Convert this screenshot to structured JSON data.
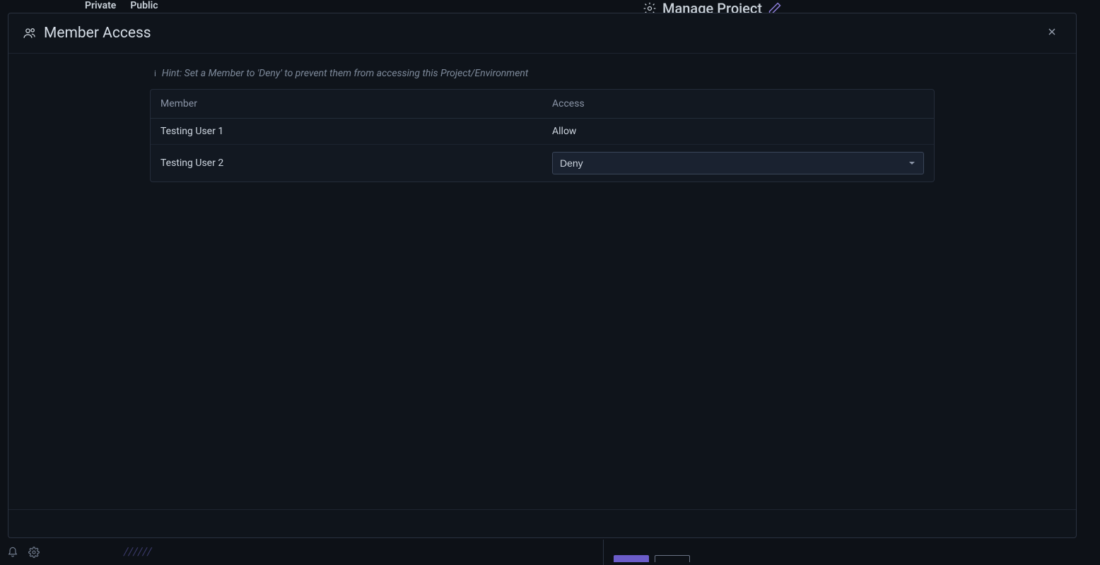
{
  "background": {
    "tabs": {
      "private": "Private",
      "public": "Public"
    },
    "manage_project": "Manage Project"
  },
  "modal": {
    "title": "Member Access",
    "hint": "Hint: Set a Member to 'Deny' to prevent them from accessing this Project/Environment",
    "table": {
      "headers": {
        "member": "Member",
        "access": "Access"
      },
      "rows": [
        {
          "member": "Testing User 1",
          "access": "Allow",
          "editable": false
        },
        {
          "member": "Testing User 2",
          "access": "Deny",
          "editable": true
        }
      ],
      "access_options": [
        "Allow",
        "Deny"
      ]
    }
  }
}
